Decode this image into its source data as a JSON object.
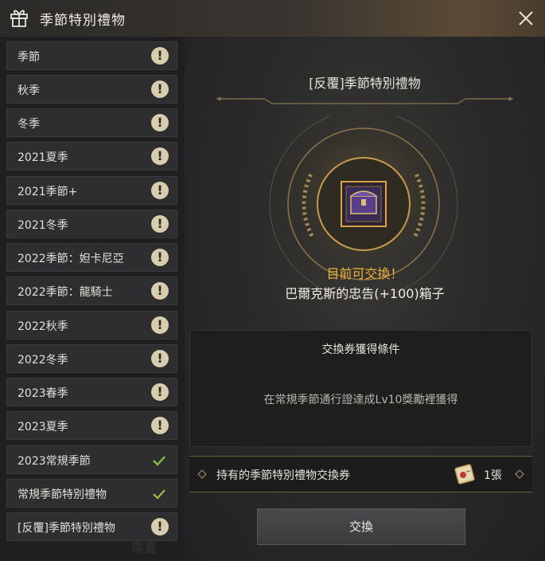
{
  "window": {
    "title": "季節特別禮物",
    "close_icon": "close-icon",
    "gift_icon": "gift-icon"
  },
  "sidebar": {
    "items": [
      {
        "label": "季節",
        "status": "warning"
      },
      {
        "label": "秋季",
        "status": "warning"
      },
      {
        "label": "冬季",
        "status": "warning"
      },
      {
        "label": "2021夏季",
        "status": "warning"
      },
      {
        "label": "2021季節+",
        "status": "warning"
      },
      {
        "label": "2021冬季",
        "status": "warning"
      },
      {
        "label": "2022季節：妲卡尼亞",
        "status": "warning"
      },
      {
        "label": "2022季節：龍騎士",
        "status": "warning"
      },
      {
        "label": "2022秋季",
        "status": "warning"
      },
      {
        "label": "2022冬季",
        "status": "warning"
      },
      {
        "label": "2023春季",
        "status": "warning"
      },
      {
        "label": "2023夏季",
        "status": "warning"
      },
      {
        "label": "2023常規季節",
        "status": "done"
      },
      {
        "label": "常規季節特別禮物",
        "status": "done"
      },
      {
        "label": "[反覆]季節特別禮物",
        "status": "warning"
      }
    ],
    "warning_symbol": "!"
  },
  "main": {
    "section_title": "[反覆]季節特別禮物",
    "available_text": "目前可交換！",
    "reward_name": "巴爾克斯的忠告(+100)箱子",
    "condition_header": "交換券獲得條件",
    "condition_desc": "在常規季節通行證達成Lv10獎勵裡獲得",
    "tickets_label": "持有的季節特別禮物交換券",
    "tickets_count": "1張",
    "exchange_button": "交換",
    "ghost_text": "需要"
  },
  "colors": {
    "accent_gold": "#f1b53a",
    "check_green": "#8fb84a",
    "warning_badge": "#d9cdb0"
  }
}
